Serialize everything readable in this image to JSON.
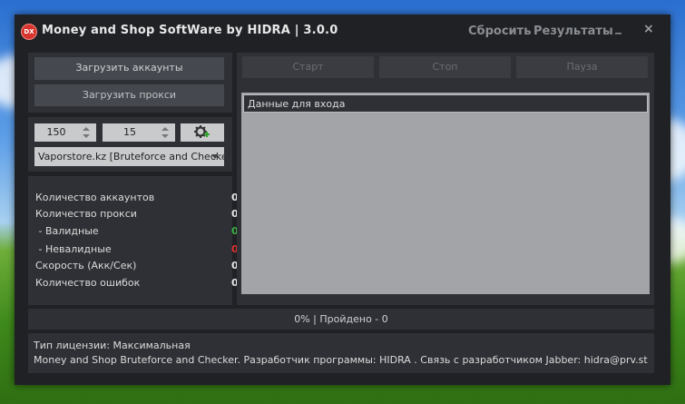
{
  "window": {
    "icon_text": "DX",
    "title": "Money and Shop SoftWare by HIDRA  | 3.0.0",
    "reset_label": "Сбросить",
    "results_label": "Результаты",
    "minimize_label": "_",
    "close_label": "×"
  },
  "left": {
    "load_accounts_label": "Загрузить аккаунты",
    "load_proxies_label": "Загрузить прокси",
    "threads_value": "150",
    "timeout_value": "15",
    "config_selected": "Vaporstore.kz [Bruteforce and Checke"
  },
  "stats": [
    {
      "label": "Количество аккаунтов",
      "value": "0",
      "color": "#e8e8e8"
    },
    {
      "label": "Количество прокси",
      "value": "0",
      "color": "#e8e8e8"
    },
    {
      "label": " - Валидные",
      "value": "0",
      "color": "#3cb043"
    },
    {
      "label": " - Невалидные",
      "value": "0",
      "color": "#e03030"
    },
    {
      "label": "Скорость (Акк/Сек)",
      "value": "0",
      "color": "#e8e8e8"
    },
    {
      "label": "Количество ошибок",
      "value": "0",
      "color": "#e8e8e8"
    }
  ],
  "controls": {
    "start_label": "Старт",
    "stop_label": "Стоп",
    "pause_label": "Пауза"
  },
  "results_list": {
    "header": "Данные для входа"
  },
  "status": {
    "progress_text": "0% | Пройдено - 0"
  },
  "info": {
    "license_line": "Тип лицензии: Максимальная",
    "developer_line": "Money and Shop Bruteforce and Checker. Разработчик программы: HIDRA . Связь с разработчиком Jabber: hidra@prv.st"
  }
}
